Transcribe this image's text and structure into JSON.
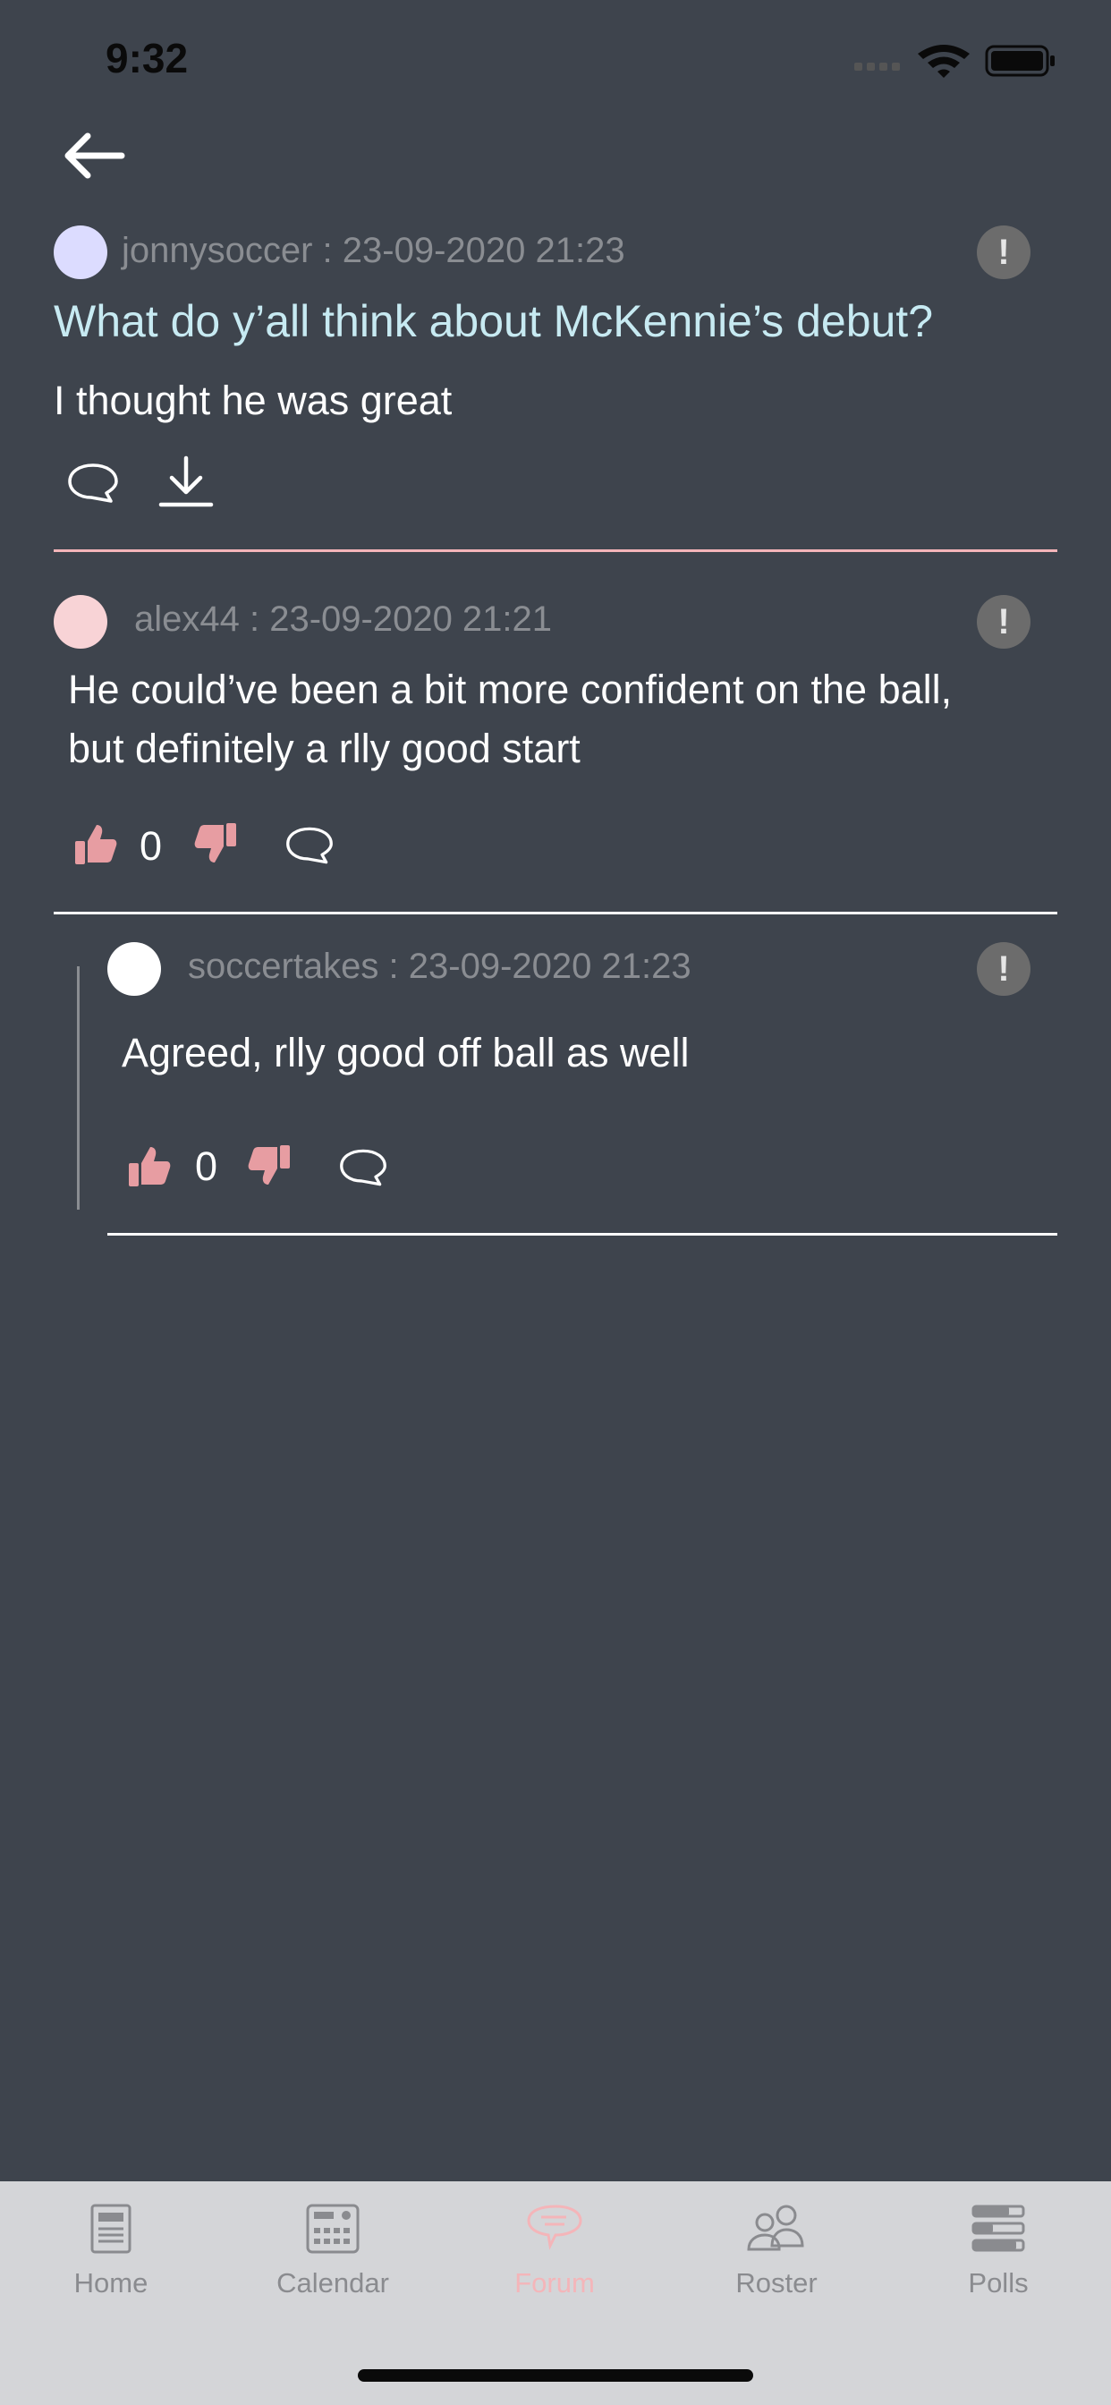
{
  "status": {
    "time": "9:32"
  },
  "post": {
    "author_meta": "jonnysoccer : 23-09-2020 21:23",
    "title": "What do y’all think about McKennie’s debut?",
    "body": "I thought he was great",
    "avatar_color": "#dcdcff"
  },
  "comments": [
    {
      "author_meta": "alex44 : 23-09-2020 21:21",
      "body_line1": "He could’ve been a bit more confident on the ball,",
      "body_line2": "but definitely a rlly good start",
      "likes": "0",
      "avatar_color": "#f8d3d6"
    },
    {
      "author_meta": "soccertakes : 23-09-2020 21:23",
      "body": "Agreed, rlly good off ball as well",
      "likes": "0",
      "avatar_color": "#ffffff"
    }
  ],
  "report_label": "!",
  "tabs": [
    {
      "label": "Home",
      "icon": "home-newspaper-icon"
    },
    {
      "label": "Calendar",
      "icon": "calendar-icon"
    },
    {
      "label": "Forum",
      "icon": "forum-icon"
    },
    {
      "label": "Roster",
      "icon": "roster-people-icon"
    },
    {
      "label": "Polls",
      "icon": "polls-icon"
    }
  ],
  "colors": {
    "background": "#3e444d",
    "accent": "#f4b5b9",
    "title": "#c7eaf2",
    "tabbar": "#d4d5d8"
  }
}
